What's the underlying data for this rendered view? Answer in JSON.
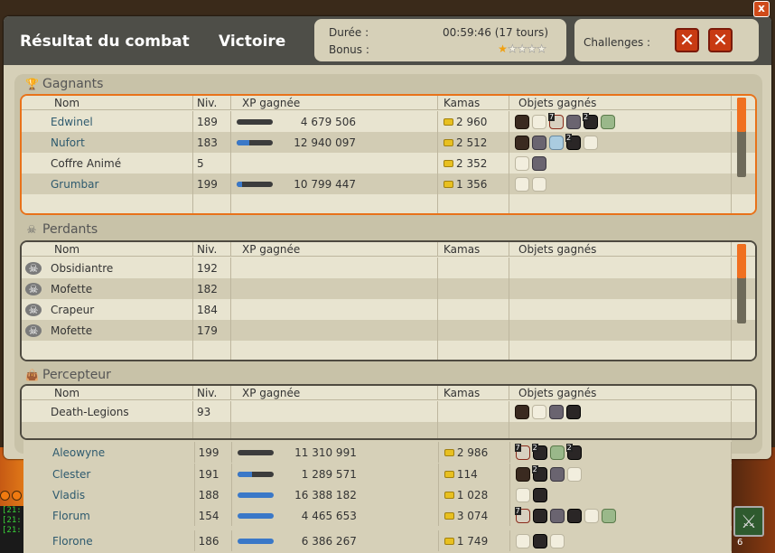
{
  "window": {
    "title": "Résultat du combat",
    "result": "Victoire",
    "close_label": "x",
    "duration_label": "Durée :",
    "duration_value": "00:59:46 (17 tours)",
    "bonus_label": "Bonus :",
    "bonus_stars": 1,
    "bonus_stars_max": 5,
    "challenges_label": "Challenges :",
    "challenge_1": "✕",
    "challenge_2": "✕"
  },
  "columns": {
    "name": "Nom",
    "level": "Niv.",
    "xp": "XP gagnée",
    "kamas": "Kamas",
    "objects": "Objets gagnés"
  },
  "sections": {
    "winners": "Gagnants",
    "losers": "Perdants",
    "collector": "Percepteur"
  },
  "winners": [
    {
      "name": "Edwinel",
      "level": "189",
      "xp": "4 679 506",
      "xp_fill": 0.0,
      "kamas": "2 960",
      "objects": [
        "dark",
        "white",
        "red:7",
        "gray",
        "black:2",
        "green"
      ]
    },
    {
      "name": "Nufort",
      "level": "183",
      "xp": "12 940 097",
      "xp_fill": 0.35,
      "kamas": "2 512",
      "objects": [
        "dark",
        "gray",
        "blue",
        "black:2",
        "white"
      ]
    },
    {
      "name": "Coffre Animé",
      "level": "5",
      "xp": "",
      "xp_fill": null,
      "kamas": "2 352",
      "objects": [
        "white",
        "gray"
      ]
    },
    {
      "name": "Grumbar",
      "level": "199",
      "xp": "10 799 447",
      "xp_fill": 0.15,
      "kamas": "1 356",
      "objects": [
        "white",
        "white"
      ]
    }
  ],
  "losers": [
    {
      "name": "Obsidiantre",
      "level": "192"
    },
    {
      "name": "Mofette",
      "level": "182"
    },
    {
      "name": "Crapeur",
      "level": "184"
    },
    {
      "name": "Mofette",
      "level": "179"
    }
  ],
  "collector": [
    {
      "name": "Death-Legions",
      "level": "93",
      "objects": [
        "dark",
        "white",
        "gray",
        "black"
      ]
    }
  ],
  "overflow": [
    {
      "name": "Aleowyne",
      "level": "199",
      "xp": "11 310 991",
      "xp_fill": 0.0,
      "kamas": "2 986",
      "objects": [
        "red:7",
        "black:2",
        "green",
        "black:2"
      ]
    },
    {
      "name": "Clester",
      "level": "191",
      "xp": "1 289 571",
      "xp_fill": 0.4,
      "kamas": "114",
      "objects": [
        "dark",
        "black:2",
        "gray",
        "white"
      ]
    },
    {
      "name": "Vladis",
      "level": "188",
      "xp": "16 388 182",
      "xp_fill": 1.0,
      "kamas": "1 028",
      "objects": [
        "white",
        "black"
      ]
    },
    {
      "name": "Florum",
      "level": "154",
      "xp": "4 465 653",
      "xp_fill": 1.0,
      "kamas": "3 074",
      "objects": [
        "red:7",
        "black",
        "gray",
        "black",
        "white",
        "green"
      ]
    },
    {
      "name": "Florone",
      "level": "186",
      "xp": "6 386 267",
      "xp_fill": 1.0,
      "kamas": "1 749",
      "objects": [
        "white",
        "black",
        "white"
      ]
    }
  ],
  "hud": {
    "sword_count": "6",
    "chat_lines": [
      "[21:",
      "[21:",
      "[21:"
    ]
  },
  "colors": {
    "accent": "#f07020",
    "header": "#4e4e48",
    "xp_fill": "#3a78c8",
    "link_name": "#2e5a6e"
  }
}
